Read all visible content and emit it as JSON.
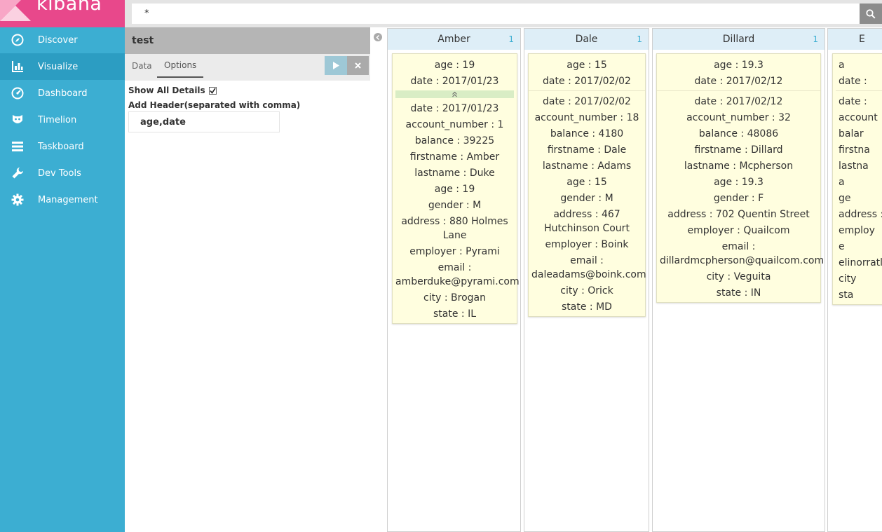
{
  "app": {
    "logo_text": "kibana",
    "brand_color": "#e8488b",
    "sidebar_color": "#3caed2"
  },
  "sidebar": {
    "items": [
      {
        "label": "Discover",
        "icon": "compass-icon",
        "active": false
      },
      {
        "label": "Visualize",
        "icon": "bar-chart-icon",
        "active": true
      },
      {
        "label": "Dashboard",
        "icon": "dashboard-gauge-icon",
        "active": false
      },
      {
        "label": "Timelion",
        "icon": "timelion-mask-icon",
        "active": false
      },
      {
        "label": "Taskboard",
        "icon": "taskboard-icon",
        "active": false
      },
      {
        "label": "Dev Tools",
        "icon": "wrench-icon",
        "active": false
      },
      {
        "label": "Management",
        "icon": "gear-icon",
        "active": false
      }
    ]
  },
  "search": {
    "value": "*"
  },
  "editor": {
    "title": "test",
    "tabs": [
      {
        "label": "Data",
        "active": false
      },
      {
        "label": "Options",
        "active": true
      }
    ],
    "show_all_details_label": "Show All Details",
    "show_all_details_checked": true,
    "add_header_label": "Add Header(separated with comma)",
    "add_header_value": "age,date"
  },
  "columns": [
    {
      "name": "Amber",
      "count": "1",
      "header_lines": [
        "age : 19",
        "date : 2017/01/23"
      ],
      "expandable": true,
      "detail_lines": [
        "date : 2017/01/23",
        "account_number : 1",
        "balance : 39225",
        "firstname : Amber",
        "lastname : Duke",
        "age : 19",
        "gender : M",
        "address : 880 Holmes Lane",
        "employer : Pyrami",
        "email : amberduke@pyrami.com",
        "city : Brogan",
        "state : IL"
      ]
    },
    {
      "name": "Dale",
      "count": "1",
      "header_lines": [
        "age : 15",
        "date : 2017/02/02"
      ],
      "expandable": false,
      "detail_lines": [
        "date : 2017/02/02",
        "account_number : 18",
        "balance : 4180",
        "firstname : Dale",
        "lastname : Adams",
        "age : 15",
        "gender : M",
        "address : 467 Hutchinson Court",
        "employer : Boink",
        "email : daleadams@boink.com",
        "city : Orick",
        "state : MD"
      ]
    },
    {
      "name": "Dillard",
      "count": "1",
      "header_lines": [
        "age : 19.3",
        "date : 2017/02/12"
      ],
      "expandable": false,
      "detail_lines": [
        "date : 2017/02/12",
        "account_number : 32",
        "balance : 48086",
        "firstname : Dillard",
        "lastname : Mcpherson",
        "age : 19.3",
        "gender : F",
        "address : 702 Quentin Street",
        "employer : Quailcom",
        "email : dillardmcpherson@quailcom.com",
        "city : Veguita",
        "state : IN"
      ]
    },
    {
      "name": "E",
      "count": "",
      "header_lines": [
        "a",
        "date :"
      ],
      "expandable": false,
      "detail_lines": [
        "date :",
        "account",
        "balar",
        "firstna",
        "lastna",
        "a",
        "ge",
        "address :",
        "employ",
        "e",
        "elinorratlif",
        "city",
        "sta"
      ]
    }
  ]
}
